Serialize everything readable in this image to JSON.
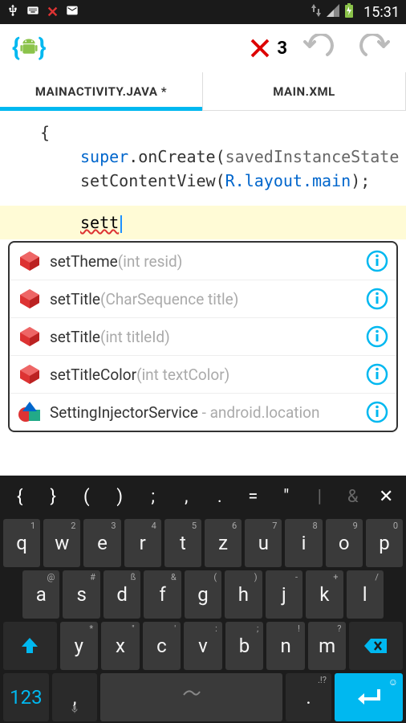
{
  "status": {
    "time": "15:31"
  },
  "toolbar": {
    "error_count": "3"
  },
  "tabs": {
    "active": "MAINACTIVITY.JAVA *",
    "inactive": "MAIN.XML"
  },
  "editor": {
    "line1_brace": "{",
    "line2_super": "super",
    "line2_dot": ".",
    "line2_onCreate": "onCreate",
    "line2_paren_open": "(",
    "line2_arg": "savedInstanceState",
    "line3_call": "setContentView",
    "line3_paren_open": "(",
    "line3_R": "R",
    "line3_dot1": ".",
    "line3_layout": "layout",
    "line3_dot2": ".",
    "line3_main": "main",
    "line3_close": ");",
    "typed": "sett"
  },
  "autocomplete": [
    {
      "name": "setTheme",
      "hint": "(int resid)",
      "icon": "method"
    },
    {
      "name": "setTitle",
      "hint": "(CharSequence title)",
      "icon": "method"
    },
    {
      "name": "setTitle",
      "hint": "(int titleId)",
      "icon": "method"
    },
    {
      "name": "setTitleColor",
      "hint": "(int textColor)",
      "icon": "method"
    },
    {
      "name": "SettingInjectorService",
      "hint": " - android.location",
      "icon": "class"
    }
  ],
  "keyboard": {
    "sym_row": [
      "{",
      "}",
      "(",
      ")",
      ";",
      ",",
      ".",
      "=",
      "\"",
      "|",
      "&",
      "✕"
    ],
    "row1": [
      {
        "k": "q",
        "s": "1"
      },
      {
        "k": "w",
        "s": "2"
      },
      {
        "k": "e",
        "s": "3"
      },
      {
        "k": "r",
        "s": "4"
      },
      {
        "k": "t",
        "s": "5"
      },
      {
        "k": "z",
        "s": "6"
      },
      {
        "k": "u",
        "s": "7"
      },
      {
        "k": "i",
        "s": "8"
      },
      {
        "k": "o",
        "s": "9"
      },
      {
        "k": "p",
        "s": "0"
      }
    ],
    "row2": [
      {
        "k": "a",
        "s": "@"
      },
      {
        "k": "s",
        "s": "#"
      },
      {
        "k": "d",
        "s": "ß"
      },
      {
        "k": "f",
        "s": "&"
      },
      {
        "k": "g",
        "s": "("
      },
      {
        "k": "h",
        "s": ")"
      },
      {
        "k": "j",
        "s": "-"
      },
      {
        "k": "k",
        "s": "+"
      },
      {
        "k": "l",
        "s": "/"
      }
    ],
    "row3": [
      {
        "k": "y",
        "s": "*"
      },
      {
        "k": "x",
        "s": "\""
      },
      {
        "k": "c",
        "s": "'"
      },
      {
        "k": "v",
        "s": ":"
      },
      {
        "k": "b",
        "s": ";"
      },
      {
        "k": "n",
        "s": "!"
      },
      {
        "k": "m",
        "s": "?"
      }
    ],
    "num_key": "123",
    "comma": ",",
    "period": ".",
    "period_sup": ".!?"
  }
}
